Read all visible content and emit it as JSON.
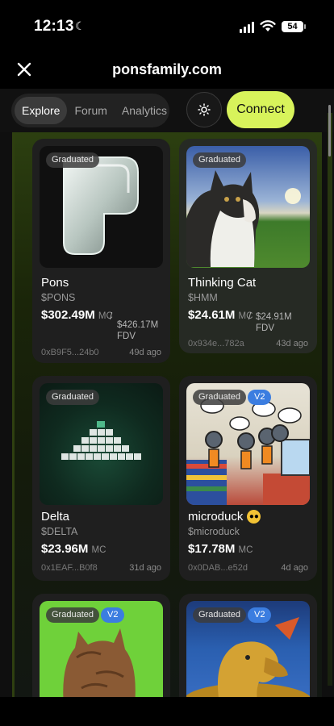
{
  "status": {
    "time": "12:13",
    "battery": "54"
  },
  "browser": {
    "url": "ponsfamily.com"
  },
  "nav": {
    "tabs": [
      {
        "label": "Explore",
        "active": true
      },
      {
        "label": "Forum",
        "active": false
      },
      {
        "label": "Analytics",
        "active": false
      }
    ],
    "connect_label": "Connect",
    "accent": "#d8f35b"
  },
  "cards": [
    {
      "badge": "Graduated",
      "name": "Pons",
      "ticker": "$PONS",
      "mc": "$302.49M",
      "mc_label": "MC",
      "fdv_sep": "/",
      "fdv": "$426.17M",
      "fdv_label": "FDV",
      "address": "0xB9F5...24b0",
      "age": "49d ago"
    },
    {
      "badge": "Graduated",
      "name": "Thinking Cat",
      "ticker": "$HMM",
      "mc": "$24.61M",
      "mc_label": "MC",
      "fdv_sep": "/",
      "fdv": "$24.91M",
      "fdv_label": "FDV",
      "address": "0x934e...782a",
      "age": "43d ago"
    },
    {
      "badge": "Graduated",
      "name": "Delta",
      "ticker": "$DELTA",
      "mc": "$23.96M",
      "mc_label": "MC",
      "address": "0x1EAF...B0f8",
      "age": "31d ago"
    },
    {
      "badge": "Graduated",
      "version": "V2",
      "name": "microduck",
      "ticker": "$microduck",
      "mc": "$17.78M",
      "mc_label": "MC",
      "address": "0x0DAB...e52d",
      "age": "4d ago"
    },
    {
      "badge": "Graduated",
      "version": "V2"
    },
    {
      "badge": "Graduated",
      "version": "V2"
    }
  ]
}
